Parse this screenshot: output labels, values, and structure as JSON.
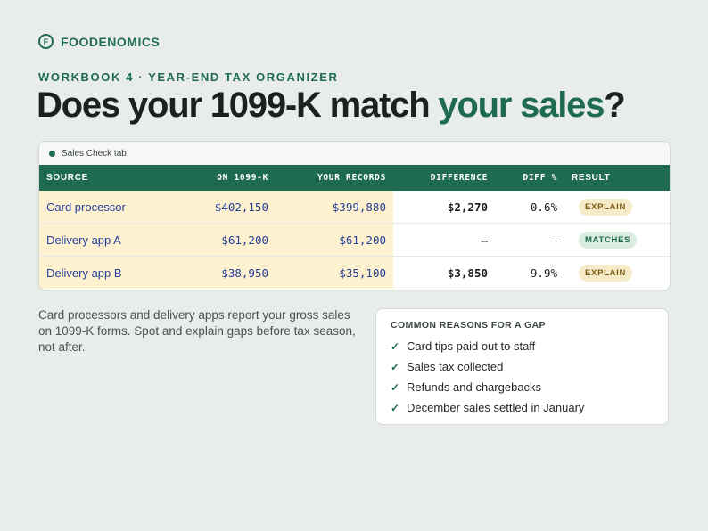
{
  "brand": {
    "name": "FOODENOMICS",
    "logo_letter": "F"
  },
  "kicker": "WORKBOOK 4 · YEAR-END TAX ORGANIZER",
  "headline": {
    "part1": "Does your 1099-K match ",
    "accent": "your sales",
    "part2": "?"
  },
  "sheet": {
    "tab_label": "Sales Check tab",
    "columns": [
      "SOURCE",
      "ON 1099-K",
      "YOUR RECORDS",
      "DIFFERENCE",
      "DIFF %",
      "RESULT"
    ],
    "rows": [
      {
        "source": "Card processor",
        "on_1099k": "$402,150",
        "records": "$399,880",
        "difference": "$2,270",
        "diff_pct": "0.6%",
        "result": "EXPLAIN"
      },
      {
        "source": "Delivery app A",
        "on_1099k": "$61,200",
        "records": "$61,200",
        "difference": "–",
        "diff_pct": "–",
        "result": "MATCHES"
      },
      {
        "source": "Delivery app B",
        "on_1099k": "$38,950",
        "records": "$35,100",
        "difference": "$3,850",
        "diff_pct": "9.9%",
        "result": "EXPLAIN"
      }
    ]
  },
  "intro": "Card processors and delivery apps report your gross sales on 1099-K forms. Spot and explain gaps before tax season, not after.",
  "reasons": {
    "title": "COMMON REASONS FOR A GAP",
    "check_glyph": "✓",
    "items": [
      "Card tips paid out to staff",
      "Sales tax collected",
      "Refunds and chargebacks",
      "December sales settled in January"
    ]
  },
  "colors": {
    "brand_green": "#1f6b52",
    "input_highlight": "#fdf1cf",
    "input_text": "#27409a",
    "background": "#e8ede9"
  }
}
